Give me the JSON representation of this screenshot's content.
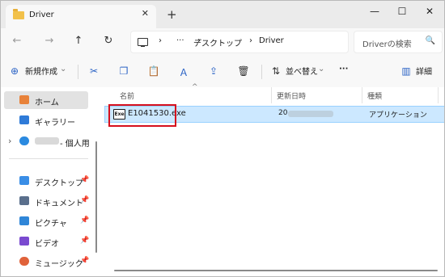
{
  "window": {
    "tab_title": "Driver",
    "close_tab": "✕",
    "new_tab": "+",
    "minimize": "—",
    "maximize": "☐",
    "close": "✕"
  },
  "address": {
    "back": "←",
    "forward": "→",
    "up": "↑",
    "refresh": "↻",
    "chevron1": "›",
    "ellipsis": "···",
    "chevron2": "›",
    "crumb1": "デスクトップ",
    "chevron3": "›",
    "crumb2": "Driver",
    "search_placeholder": "Driverの検索"
  },
  "toolbar": {
    "new_label": "新規作成",
    "new_caret": "⌄",
    "sort_label": "並べ替え",
    "sort_caret": "⌄",
    "more": "···",
    "details_label": "詳細"
  },
  "sidebar": {
    "items": [
      {
        "label": "ホーム",
        "color": "#e8823a"
      },
      {
        "label": "ギャラリー",
        "color": "#2f7bd8"
      },
      {
        "label": "- 個人用",
        "color": "#2b8ae0"
      },
      {
        "label": "デスクトップ",
        "color": "#3a8ee6"
      },
      {
        "label": "ドキュメント",
        "color": "#5a6f8c"
      },
      {
        "label": "ピクチャ",
        "color": "#2f86d8"
      },
      {
        "label": "ビデオ",
        "color": "#7a4ad0"
      },
      {
        "label": "ミュージック",
        "color": "#e0623a"
      }
    ],
    "pin": "📌",
    "expand": "›"
  },
  "list": {
    "headers": [
      "名前",
      "更新日時",
      "種類"
    ],
    "sort_indicator": "^",
    "rows": [
      {
        "icon": "exe-icon",
        "icon_text": "Exe",
        "name": "E1041530.exe",
        "date": "20",
        "type": "アプリケーション"
      }
    ]
  }
}
